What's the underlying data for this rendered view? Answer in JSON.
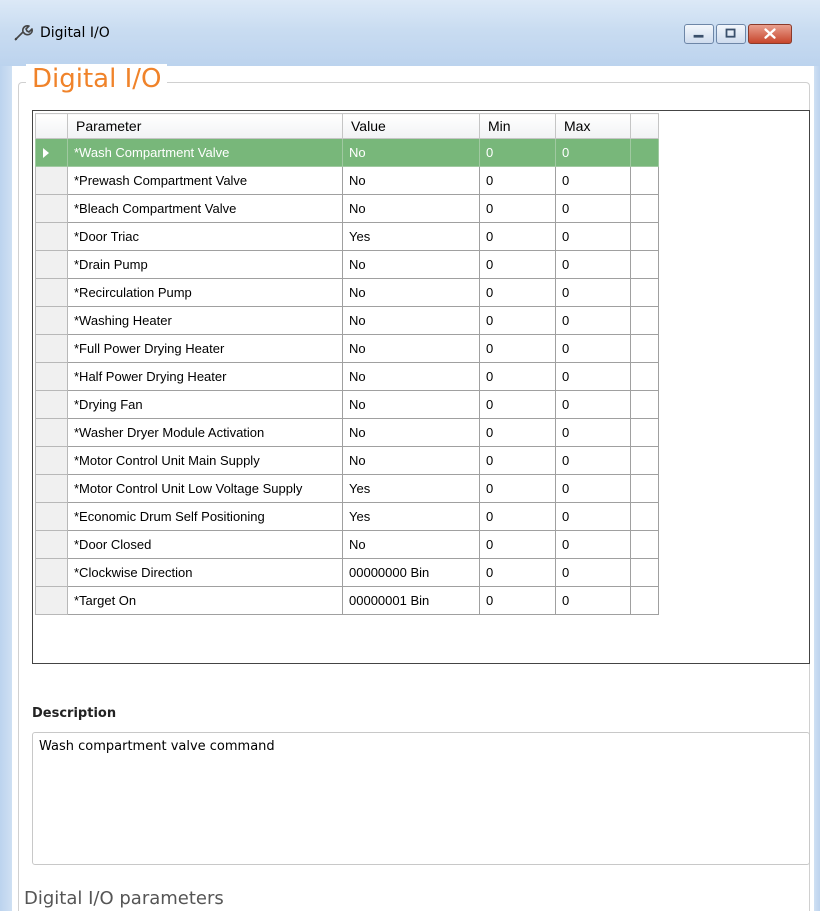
{
  "window": {
    "title": "Digital I/O",
    "icon": "wrench-icon",
    "controls": [
      "minimize-icon",
      "maximize-icon",
      "close-icon"
    ]
  },
  "group": {
    "title": "Digital I/O"
  },
  "table": {
    "columns": [
      "Parameter",
      "Value",
      "Min",
      "Max"
    ],
    "selected_row": 0,
    "selection_color": "#78b77a",
    "rows": [
      {
        "parameter": "*Wash Compartment Valve",
        "value": "No",
        "min": "0",
        "max": "0"
      },
      {
        "parameter": "*Prewash Compartment Valve",
        "value": "No",
        "min": "0",
        "max": "0"
      },
      {
        "parameter": "*Bleach Compartment Valve",
        "value": "No",
        "min": "0",
        "max": "0"
      },
      {
        "parameter": "*Door Triac",
        "value": "Yes",
        "min": "0",
        "max": "0"
      },
      {
        "parameter": "*Drain Pump",
        "value": "No",
        "min": "0",
        "max": "0"
      },
      {
        "parameter": "*Recirculation Pump",
        "value": "No",
        "min": "0",
        "max": "0"
      },
      {
        "parameter": "*Washing Heater",
        "value": "No",
        "min": "0",
        "max": "0"
      },
      {
        "parameter": "*Full Power Drying Heater",
        "value": "No",
        "min": "0",
        "max": "0"
      },
      {
        "parameter": "*Half Power Drying Heater",
        "value": "No",
        "min": "0",
        "max": "0"
      },
      {
        "parameter": "*Drying Fan",
        "value": "No",
        "min": "0",
        "max": "0"
      },
      {
        "parameter": "*Washer Dryer Module Activation",
        "value": "No",
        "min": "0",
        "max": "0"
      },
      {
        "parameter": "*Motor Control Unit Main Supply",
        "value": "No",
        "min": "0",
        "max": "0"
      },
      {
        "parameter": "*Motor Control Unit Low Voltage Supply",
        "value": "Yes",
        "min": "0",
        "max": "0"
      },
      {
        "parameter": "*Economic Drum Self Positioning",
        "value": "Yes",
        "min": "0",
        "max": "0"
      },
      {
        "parameter": "*Door Closed",
        "value": "No",
        "min": "0",
        "max": "0"
      },
      {
        "parameter": "*Clockwise Direction",
        "value": "00000000 Bin",
        "min": "0",
        "max": "0"
      },
      {
        "parameter": "*Target On",
        "value": "00000001 Bin",
        "min": "0",
        "max": "0"
      }
    ]
  },
  "description": {
    "label": "Description",
    "text": "Wash compartment valve command"
  },
  "footer": {
    "text": "Digital I/O parameters"
  }
}
